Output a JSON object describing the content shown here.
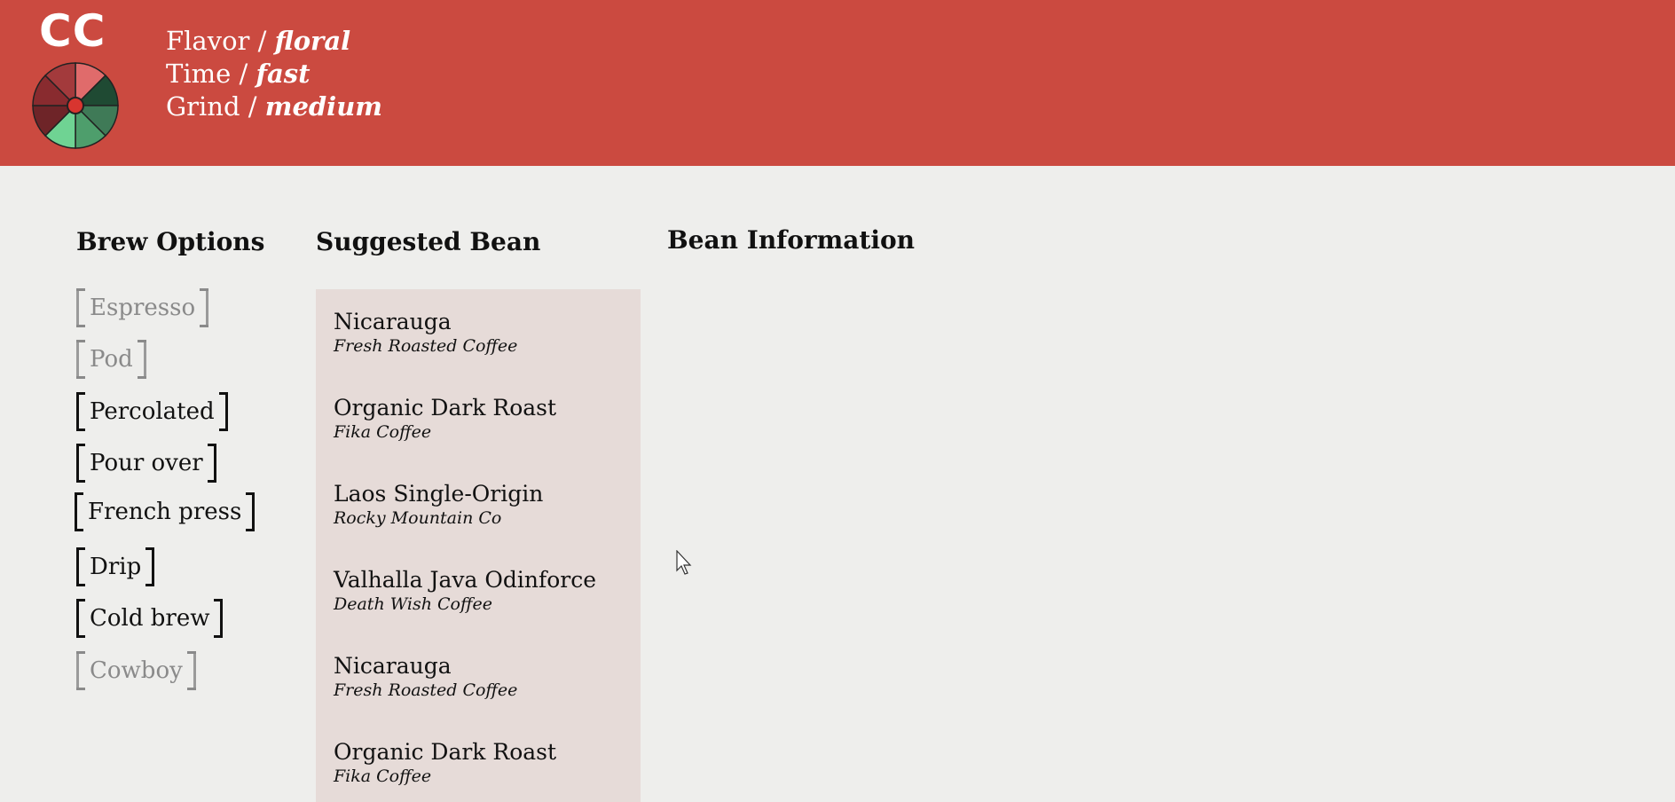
{
  "header": {
    "logo": "CC",
    "filters": [
      {
        "label": "Flavor / ",
        "value": "floral"
      },
      {
        "label": "Time / ",
        "value": "fast"
      },
      {
        "label": "Grind / ",
        "value": "medium"
      }
    ],
    "wheel_colors": [
      "#e06b6b",
      "#1f4a33",
      "#3f7a57",
      "#4e9e6c",
      "#6fd393",
      "#6e2428",
      "#892b2f",
      "#a33a3c"
    ],
    "accent": "#cb4a40"
  },
  "brew_options": {
    "title": "Brew Options",
    "items": [
      {
        "label": "Espresso",
        "enabled": false
      },
      {
        "label": "Pod",
        "enabled": false
      },
      {
        "label": "Percolated",
        "enabled": true
      },
      {
        "label": "Pour over",
        "enabled": true
      },
      {
        "label": "French press",
        "enabled": true
      },
      {
        "label": "Drip",
        "enabled": true
      },
      {
        "label": "Cold brew",
        "enabled": true
      },
      {
        "label": "Cowboy",
        "enabled": false
      }
    ]
  },
  "suggested_bean": {
    "title": "Suggested Bean",
    "items": [
      {
        "name": "Nicarauga",
        "roaster": "Fresh Roasted Coffee"
      },
      {
        "name": "Organic Dark Roast",
        "roaster": "Fika Coffee"
      },
      {
        "name": "Laos Single-Origin",
        "roaster": "Rocky Mountain Co"
      },
      {
        "name": "Valhalla Java Odinforce",
        "roaster": "Death Wish Coffee"
      },
      {
        "name": "Nicarauga",
        "roaster": "Fresh Roasted Coffee"
      },
      {
        "name": "Organic Dark Roast",
        "roaster": "Fika Coffee"
      }
    ]
  },
  "bean_information": {
    "title": "Bean Information"
  }
}
